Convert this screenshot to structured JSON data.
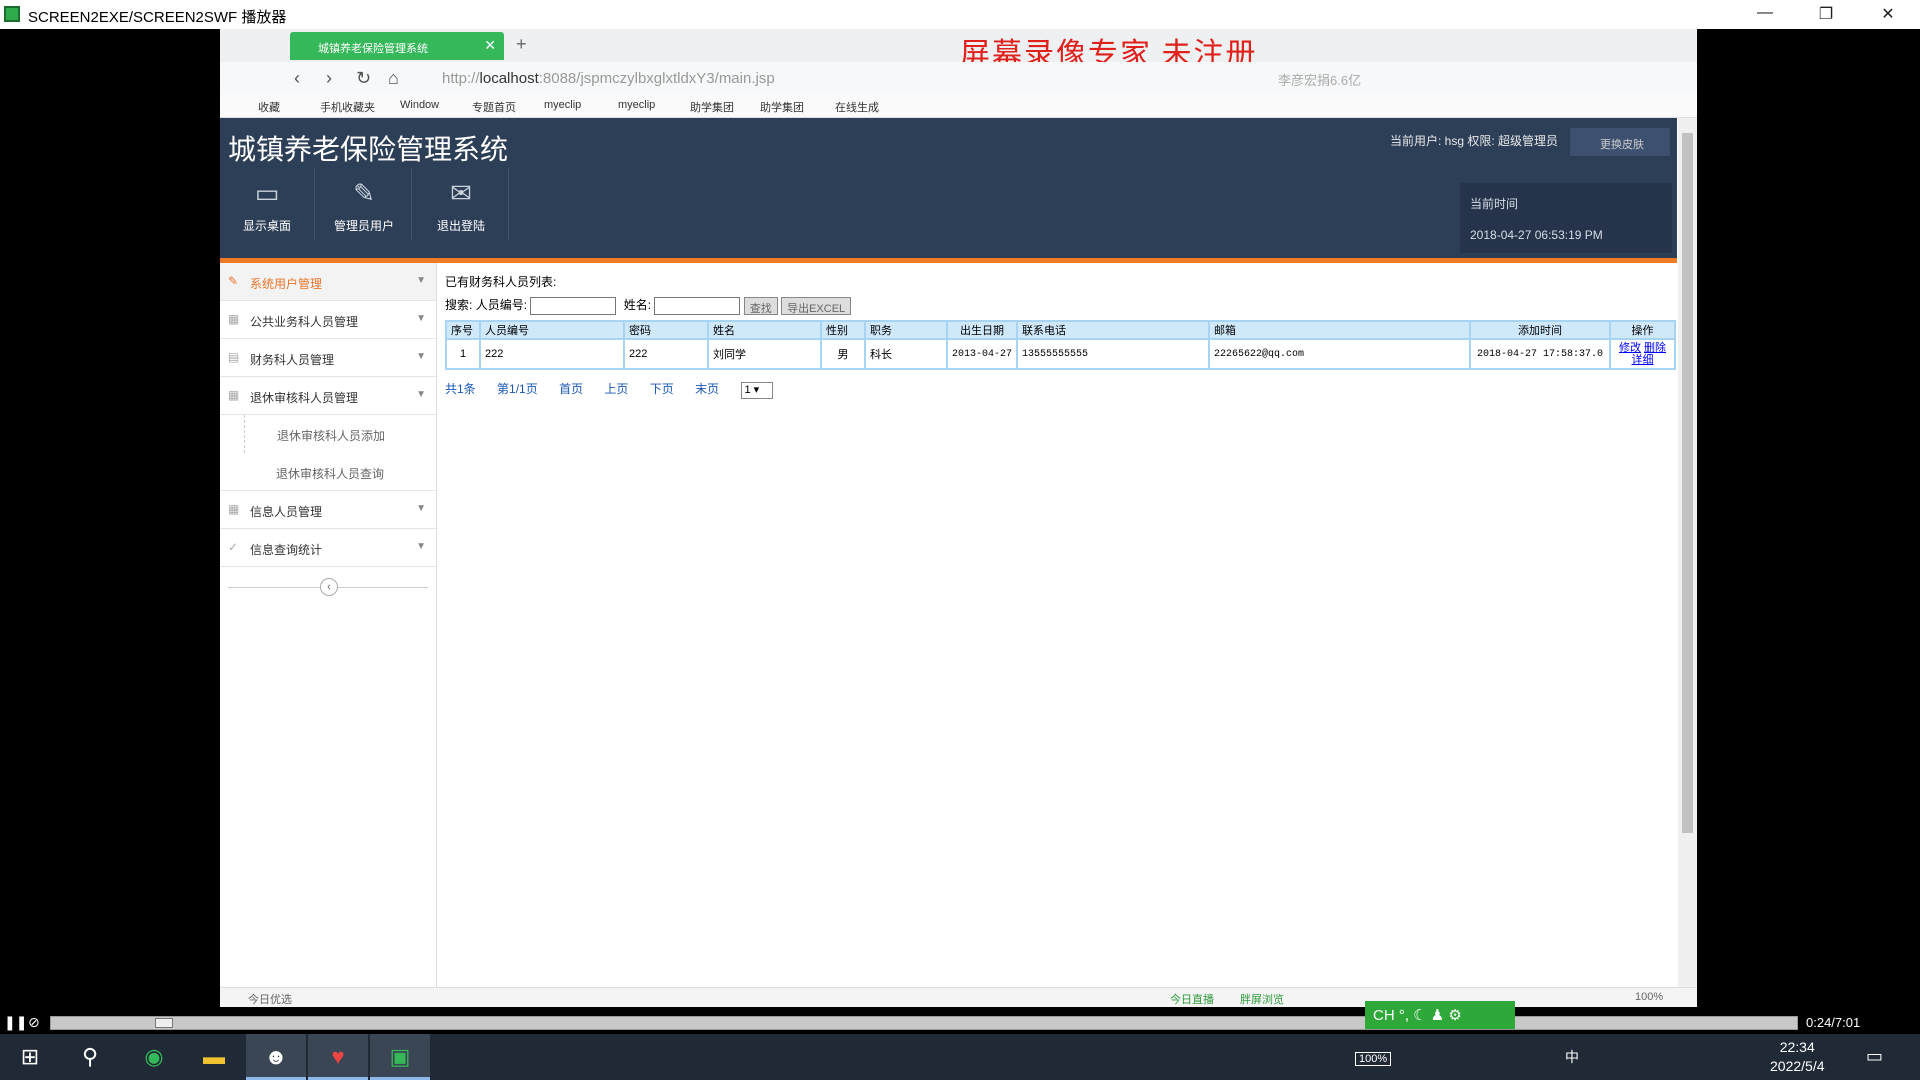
{
  "outer_window": {
    "title": "SCREEN2EXE/SCREEN2SWF 播放器",
    "min": "—",
    "max": "❐",
    "close": "✕"
  },
  "browser": {
    "tab_title": "城镇养老保险管理系统",
    "tab_close": "✕",
    "new_tab": "+",
    "watermark": "屏幕录像专家  未注册",
    "url_prefix": "http://",
    "url_host": "localhost",
    "url_rest": ":8088/jspmczylbxglxtldxY3/main.jsp",
    "search_placeholder": "李彦宏捐6.6亿",
    "bookmarks": [
      "收藏",
      "手机收藏夹",
      "Window",
      "专题首页",
      "myeclip",
      "myeclip",
      "助学集团",
      "助学集团",
      "在线生成"
    ]
  },
  "header": {
    "title": "城镇养老保险管理系统",
    "user_info": "当前用户: hsg 权限: 超级管理员",
    "skin_label": "更换皮肤",
    "buttons": [
      {
        "label": "显示桌面",
        "icon": "monitor-icon"
      },
      {
        "label": "管理员用户",
        "icon": "pencil-icon"
      },
      {
        "label": "退出登陆",
        "icon": "envelope-icon"
      }
    ],
    "time_label": "当前时间",
    "time_value": "2018-04-27 06:53:19 PM"
  },
  "sidebar": {
    "items": [
      {
        "label": "系统用户管理",
        "active": true
      },
      {
        "label": "公共业务科人员管理"
      },
      {
        "label": "财务科人员管理"
      },
      {
        "label": "退休审核科人员管理"
      }
    ],
    "sub_items": [
      "退休审核科人员添加",
      "退休审核科人员查询"
    ],
    "items2": [
      {
        "label": "信息人员管理"
      },
      {
        "label": "信息查询统计"
      }
    ]
  },
  "content": {
    "list_title": "已有财务科人员列表:",
    "search_label": "搜索:",
    "field1_label": "人员编号:",
    "field2_label": "姓名:",
    "find_button": "查找",
    "export_button": "导出EXCEL",
    "columns": [
      "序号",
      "人员编号",
      "密码",
      "姓名",
      "性别",
      "职务",
      "出生日期",
      "联系电话",
      "邮箱",
      "添加时间",
      "操作"
    ],
    "rows": [
      {
        "no": "1",
        "code": "222",
        "pwd": "222",
        "name": "刘同学",
        "sex": "男",
        "post": "科长",
        "birth": "2013-04-27",
        "phone": "13555555555",
        "email": "22265622@qq.com",
        "added": "2018-04-27 17:58:37.0",
        "op_edit": "修改",
        "op_delete": "删除",
        "op_detail": "详细"
      }
    ],
    "pager": {
      "total": "共1条",
      "page": "第1/1页",
      "first": "首页",
      "prev": "上页",
      "next": "下页",
      "last": "末页",
      "select": "1 ▾"
    }
  },
  "statusbar": {
    "left": "今日优选",
    "items": [
      "今日直播",
      "胖屏浏览",
      "100%"
    ]
  },
  "player": {
    "time": "0:24/7:01"
  },
  "ime": {
    "label": "CH °, ☾ ♟ ⚙"
  },
  "taskbar": {
    "time": "22:34",
    "date": "2022/5/4",
    "battery": "100%",
    "lang": "中"
  }
}
